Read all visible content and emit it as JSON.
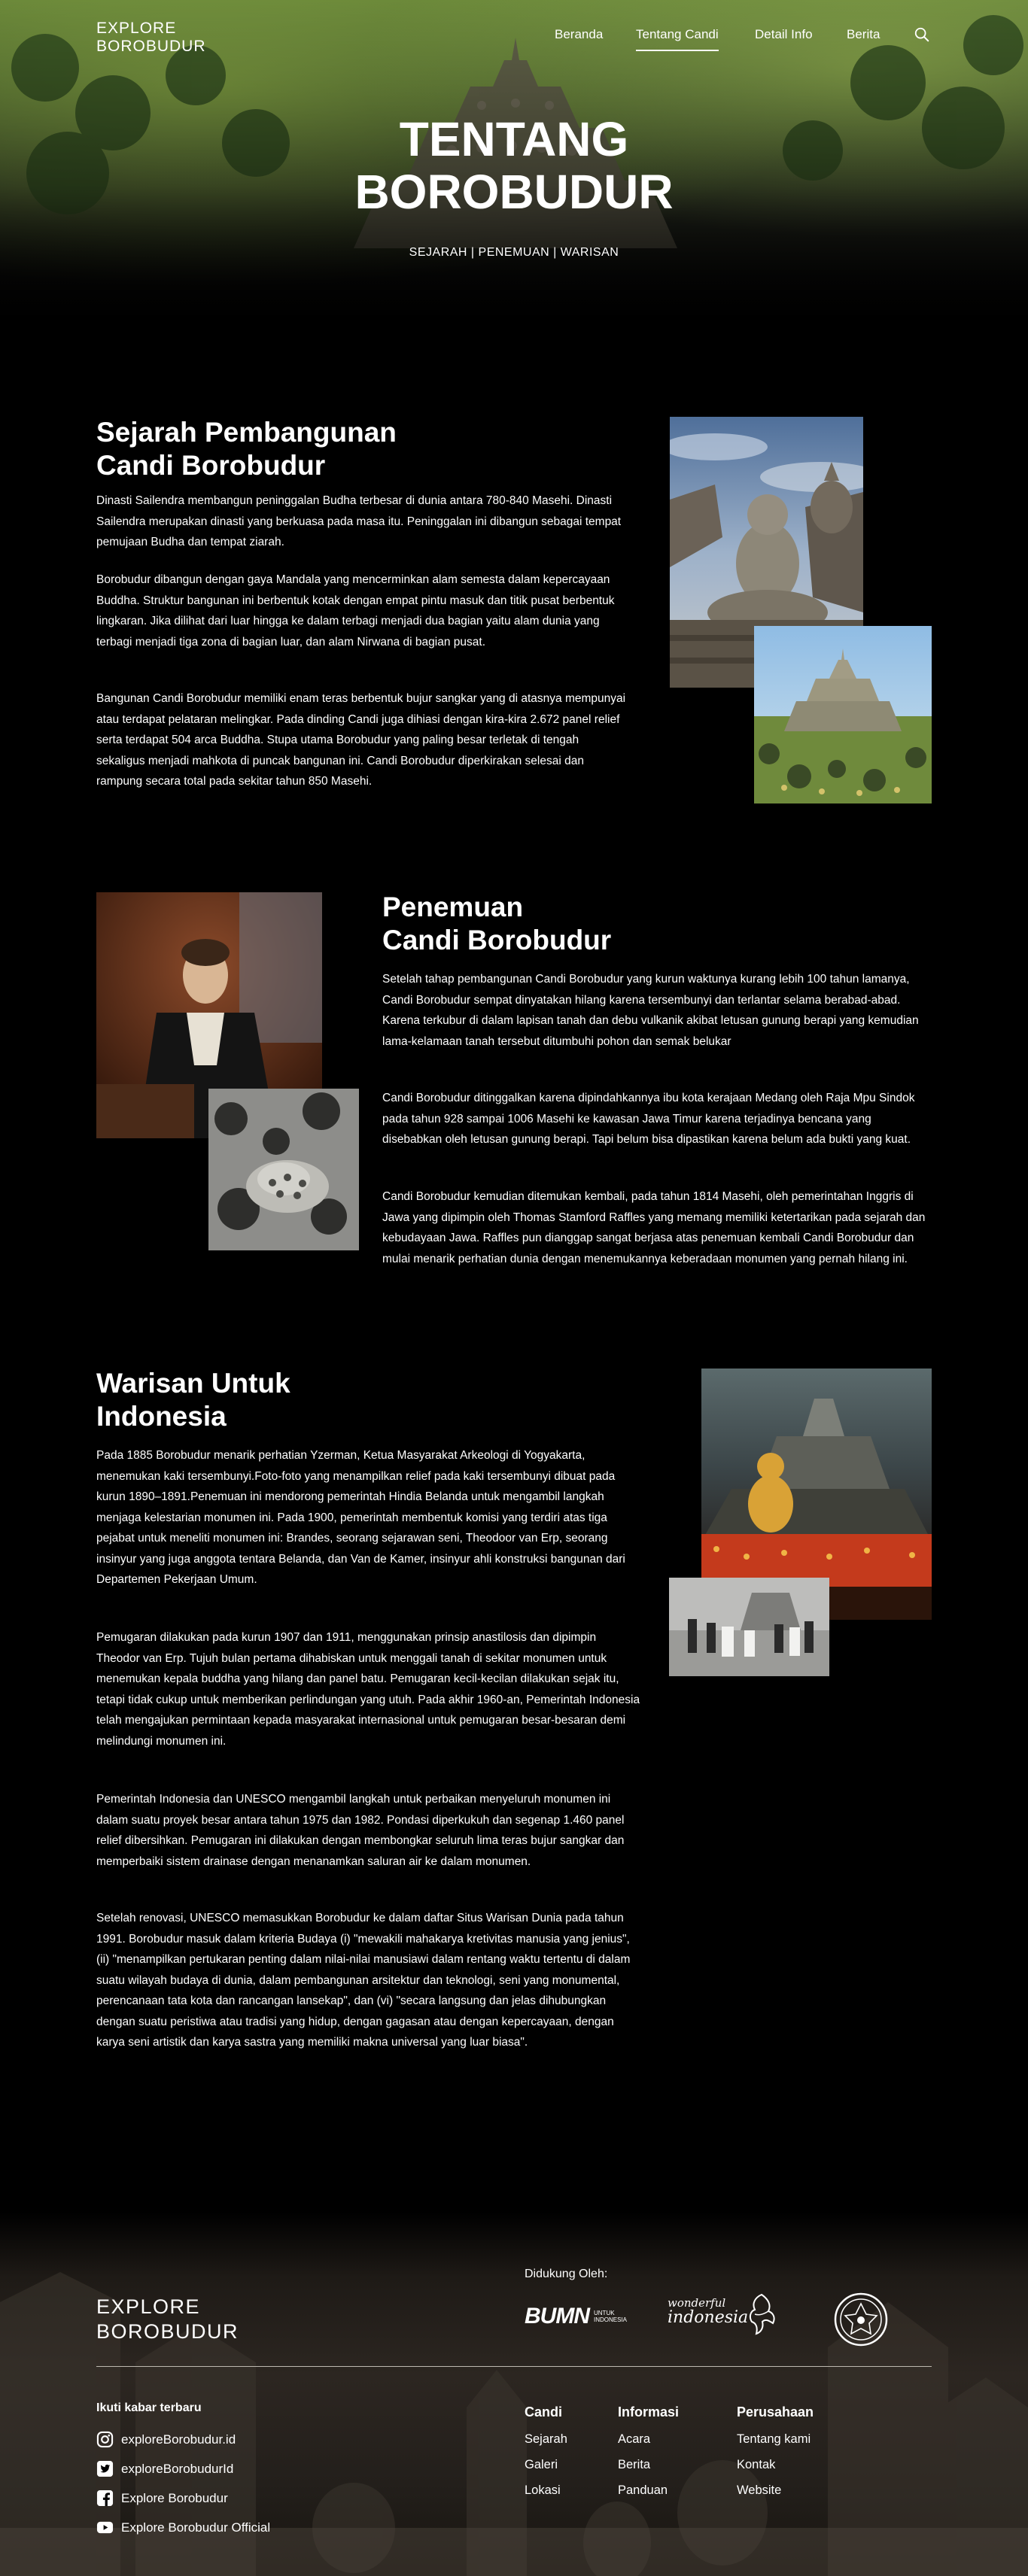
{
  "header": {
    "logo_line1": "EXPLORE",
    "logo_line2": "BOROBUDUR",
    "nav": [
      "Beranda",
      "Tentang Candi",
      "Detail Info",
      "Berita"
    ],
    "active_nav": "Tentang Candi"
  },
  "hero": {
    "title_line1": "TENTANG",
    "title_line2": "BOROBUDUR",
    "subtitle": "SEJARAH | PENEMUAN | WARISAN"
  },
  "sejarah": {
    "title_line1": "Sejarah Pembangunan",
    "title_line2": "Candi Borobudur",
    "paragraphs": [
      "Dinasti Sailendra membangun peninggalan Budha terbesar di dunia antara 780-840 Masehi. Dinasti Sailendra merupakan dinasti yang berkuasa pada masa itu. Peninggalan ini dibangun sebagai tempat pemujaan Budha dan tempat ziarah.",
      "Borobudur dibangun dengan gaya Mandala yang mencerminkan alam semesta dalam kepercayaan Buddha. Struktur bangunan ini berbentuk kotak dengan empat pintu masuk dan titik pusat berbentuk lingkaran. Jika dilihat dari luar hingga ke dalam terbagi menjadi dua bagian yaitu alam dunia yang terbagi menjadi tiga zona di bagian luar, dan alam Nirwana di bagian pusat.",
      "Bangunan Candi Borobudur memiliki enam teras berbentuk bujur sangkar yang di atasnya mempunyai atau terdapat pelataran melingkar. Pada dinding Candi juga dihiasi dengan kira-kira 2.672 panel relief serta terdapat 504 arca Buddha. Stupa utama Borobudur yang paling besar terletak di tengah sekaligus menjadi mahkota di puncak bangunan ini. Candi Borobudur diperkirakan selesai dan rampung secara total pada sekitar tahun 850 Masehi."
    ]
  },
  "penemuan": {
    "title_line1": "Penemuan",
    "title_line2": "Candi Borobudur",
    "paragraphs": [
      "Setelah tahap pembangunan Candi Borobudur yang kurun waktunya kurang lebih 100 tahun lamanya, Candi Borobudur sempat dinyatakan hilang karena tersembunyi dan terlantar selama berabad-abad. Karena terkubur di dalam lapisan tanah dan debu vulkanik akibat letusan gunung berapi yang kemudian lama-kelamaan tanah tersebut ditumbuhi pohon dan semak belukar",
      "Candi Borobudur ditinggalkan karena dipindahkannya ibu kota kerajaan Medang oleh Raja Mpu Sindok pada tahun 928 sampai 1006 Masehi ke kawasan Jawa Timur karena terjadinya bencana yang disebabkan oleh letusan gunung berapi. Tapi belum bisa dipastikan karena belum ada bukti yang kuat.",
      "Candi Borobudur kemudian ditemukan kembali, pada tahun 1814 Masehi, oleh pemerintahan Inggris di Jawa yang dipimpin oleh Thomas Stamford Raffles yang memang memiliki ketertarikan pada sejarah dan kebudayaan Jawa. Raffles pun dianggap sangat berjasa atas penemuan kembali Candi Borobudur dan mulai menarik perhatian dunia dengan menemukannya keberadaan monumen yang pernah hilang ini."
    ]
  },
  "warisan": {
    "title_line1": "Warisan Untuk",
    "title_line2": "Indonesia",
    "paragraphs": [
      "Pada 1885 Borobudur menarik perhatian Yzerman, Ketua Masyarakat Arkeologi di Yogyakarta, menemukan kaki tersembunyi.Foto-foto yang menampilkan relief pada kaki tersembunyi dibuat pada kurun 1890–1891.Penemuan ini mendorong pemerintah Hindia Belanda untuk mengambil langkah menjaga kelestarian monumen ini. Pada 1900, pemerintah membentuk komisi yang terdiri atas tiga pejabat untuk meneliti monumen ini: Brandes, seorang sejarawan seni, Theodoor van Erp, seorang insinyur yang juga anggota tentara Belanda, dan Van de Kamer, insinyur ahli konstruksi bangunan dari Departemen Pekerjaan Umum.",
      "Pemugaran dilakukan pada kurun 1907 dan 1911, menggunakan prinsip anastilosis dan dipimpin Theodor van Erp. Tujuh bulan pertama dihabiskan untuk menggali tanah di sekitar monumen untuk menemukan kepala buddha yang hilang dan panel batu. Pemugaran kecil-kecilan dilakukan sejak itu, tetapi tidak cukup untuk memberikan perlindungan yang utuh. Pada akhir 1960-an, Pemerintah Indonesia telah mengajukan permintaan kepada masyarakat internasional untuk pemugaran besar-besaran demi melindungi monumen ini.",
      "Pemerintah Indonesia dan UNESCO mengambil langkah untuk perbaikan menyeluruh monumen ini dalam suatu proyek besar antara tahun 1975 dan 1982. Pondasi diperkukuh dan segenap 1.460 panel relief dibersihkan. Pemugaran ini dilakukan dengan membongkar seluruh lima teras bujur sangkar dan memperbaiki sistem drainase dengan menanamkan saluran air ke dalam monumen.",
      "Setelah renovasi, UNESCO memasukkan Borobudur ke dalam daftar Situs Warisan Dunia pada tahun 1991. Borobudur masuk dalam kriteria Budaya (i) \"mewakili mahakarya kretivitas manusia yang jenius\", (ii) \"menampilkan pertukaran penting dalam nilai-nilai manusiawi dalam rentang waktu tertentu di dalam suatu wilayah budaya di dunia, dalam pembangunan arsitektur dan teknologi, seni yang monumental, perencanaan tata kota dan rancangan lansekap\", dan (vi) \"secara langsung dan jelas dihubungkan dengan suatu peristiwa atau tradisi yang hidup, dengan gagasan atau dengan kepercayaan, dengan karya seni artistik dan karya sastra yang memiliki makna universal yang luar biasa\"."
    ]
  },
  "footer": {
    "logo_line1": "EXPLORE",
    "logo_line2": "BOROBUDUR",
    "didukung": "Didukung Oleh:",
    "sponsor_bumn": "BUMN",
    "sponsor_bumn_sub": "UNTUK INDONESIA",
    "sponsor_wonderful": "wonderful",
    "sponsor_indonesia": "indonesia",
    "ikuti": "Ikuti kabar terbaru",
    "social": [
      {
        "icon": "instagram-icon",
        "label": "exploreBorobudur.id"
      },
      {
        "icon": "twitter-icon",
        "label": "exploreBorobudurId"
      },
      {
        "icon": "facebook-icon",
        "label": "Explore Borobudur"
      },
      {
        "icon": "youtube-icon",
        "label": "Explore Borobudur Official"
      }
    ],
    "columns": [
      {
        "title": "Candi",
        "links": [
          "Sejarah",
          "Galeri",
          "Lokasi"
        ]
      },
      {
        "title": "Informasi",
        "links": [
          "Acara",
          "Berita",
          "Panduan"
        ]
      },
      {
        "title": "Perusahaan",
        "links": [
          "Tentang kami",
          "Kontak",
          "Website"
        ]
      }
    ]
  }
}
